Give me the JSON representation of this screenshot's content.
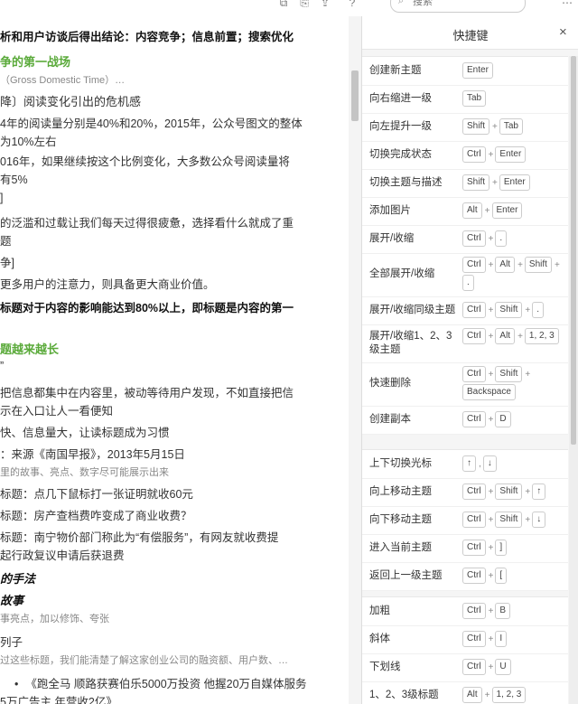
{
  "toolbar": {
    "search_placeholder": "搜索",
    "icons": [
      "share-icon",
      "export-icon",
      "help-icon",
      "more-icon"
    ]
  },
  "doc": {
    "lines": [
      {
        "t": "析和用户访谈后得出结论：内容竞争；信息前置；搜索优化",
        "cls": "bold"
      },
      {
        "t": "争的第一战场",
        "cls": "green"
      },
      {
        "t": "（Gross Domestic Time）…",
        "cls": "sub"
      },
      {
        "t": "降〕阅读变化引出的危机感",
        "cls": "big"
      },
      {
        "t": "4年的阅读量分别是40%和20%，2015年，公众号图文的整体",
        "cls": ""
      },
      {
        "t": "为10%左右",
        "cls": ""
      },
      {
        "t": "016年，如果继续按这个比例变化，大多数公众号阅读量将",
        "cls": ""
      },
      {
        "t": "有5%",
        "cls": ""
      },
      {
        "t": "]",
        "cls": ""
      },
      {
        "t": "的泛滥和过载让我们每天过得很疲惫，选择看什么就成了重",
        "cls": ""
      },
      {
        "t": "题",
        "cls": ""
      },
      {
        "t": "争]",
        "cls": ""
      },
      {
        "t": "更多用户的注意力，则具备更大商业价值。",
        "cls": ""
      },
      {
        "t": "标题对于内容的影响能达到80%以上，即标题是内容的第一",
        "cls": "bold"
      },
      {
        "t": "题越来越长",
        "cls": "green"
      },
      {
        "t": "”",
        "cls": ""
      },
      {
        "t": "把信息都集中在内容里，被动等待用户发现，不如直接把信",
        "cls": ""
      },
      {
        "t": "示在入口让人一看便知",
        "cls": ""
      },
      {
        "t": "快、信息量大，让读标题成为习惯",
        "cls": ""
      },
      {
        "t": "：来源《南国早报》，2013年5月15日",
        "cls": ""
      },
      {
        "t": "里的故事、亮点、数字尽可能展示出来",
        "cls": "sub"
      },
      {
        "t": "标题：点几下鼠标打一张证明就收60元",
        "cls": ""
      },
      {
        "t": "标题：房产查档费咋变成了商业收费？",
        "cls": ""
      },
      {
        "t": "标题：南宁物价部门称此为“有偿服务”，有网友就收费提",
        "cls": ""
      },
      {
        "t": "起行政复议申请后获退费",
        "cls": ""
      },
      {
        "t": "的手法",
        "cls": "h-italic"
      },
      {
        "t": "故事",
        "cls": "h-italic"
      },
      {
        "t": "事亮点，加以修饰、夸张",
        "cls": "sub"
      },
      {
        "t": "列子",
        "cls": ""
      },
      {
        "t": "过这些标题，我们能清楚了解这家创业公司的融资额、用户数、…",
        "cls": "sub"
      },
      {
        "t": "《跑全马 顺路获赛伯乐5000万投资 他握20万自媒体服务",
        "cls": "",
        "bullet": true
      },
      {
        "t": "5万广告主 年营收2亿》",
        "cls": ""
      }
    ]
  },
  "panel": {
    "title": "快捷键",
    "close_label": "×",
    "groups": [
      {
        "items": [
          {
            "label": "创建新主题",
            "keys": [
              "Enter"
            ]
          },
          {
            "label": "向右缩进一级",
            "keys": [
              "Tab"
            ]
          },
          {
            "label": "向左提升一级",
            "keys": [
              "Shift",
              "Tab"
            ]
          },
          {
            "label": "切换完成状态",
            "keys": [
              "Ctrl",
              "Enter"
            ]
          },
          {
            "label": "切换主题与描述",
            "keys": [
              "Shift",
              "Enter"
            ]
          },
          {
            "label": "添加图片",
            "keys": [
              "Alt",
              "Enter"
            ]
          },
          {
            "label": "展开/收缩",
            "keys": [
              "Ctrl",
              "."
            ]
          },
          {
            "label": "全部展开/收缩",
            "keys": [
              "Ctrl",
              "Alt",
              "Shift",
              "."
            ]
          },
          {
            "label": "展开/收缩同级主题",
            "keys": [
              "Ctrl",
              "Shift",
              "."
            ]
          },
          {
            "label": "展开/收缩1、2、3级主题",
            "keys": [
              "Ctrl",
              "Alt",
              "1, 2, 3"
            ]
          },
          {
            "label": "快速删除",
            "keys": [
              "Ctrl",
              "Shift",
              "Backspace"
            ]
          },
          {
            "label": "创建副本",
            "keys": [
              "Ctrl",
              "D"
            ]
          }
        ]
      },
      {
        "items": [
          {
            "label": "上下切换光标",
            "keys": [
              "↑",
              "↓"
            ],
            "sep": ","
          },
          {
            "label": "向上移动主题",
            "keys": [
              "Ctrl",
              "Shift",
              "↑"
            ]
          },
          {
            "label": "向下移动主题",
            "keys": [
              "Ctrl",
              "Shift",
              "↓"
            ]
          },
          {
            "label": "进入当前主题",
            "keys": [
              "Ctrl",
              "]"
            ]
          },
          {
            "label": "返回上一级主题",
            "keys": [
              "Ctrl",
              "["
            ]
          }
        ]
      },
      {
        "items": [
          {
            "label": "加粗",
            "keys": [
              "Ctrl",
              "B"
            ]
          },
          {
            "label": "斜体",
            "keys": [
              "Ctrl",
              "I"
            ]
          },
          {
            "label": "下划线",
            "keys": [
              "Ctrl",
              "U"
            ]
          },
          {
            "label": "1、2、3级标题",
            "keys": [
              "Alt",
              "1, 2, 3"
            ]
          }
        ]
      }
    ]
  }
}
